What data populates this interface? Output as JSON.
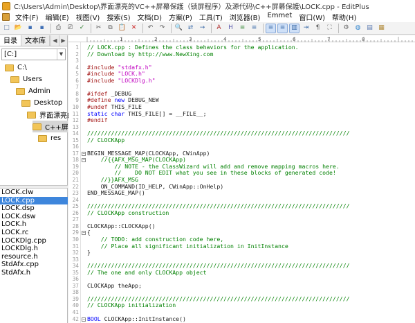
{
  "window": {
    "title": "C:\\Users\\Admin\\Desktop\\界面漂亮的VC++屏幕保護（锁屏程序）及源代码\\C++屏幕保護\\LOCK.cpp - EditPlus"
  },
  "menu": [
    "文件(F)",
    "编辑(E)",
    "视图(V)",
    "搜索(S)",
    "文档(D)",
    "方案(P)",
    "工具(T)",
    "浏览器(B)",
    "Emmet",
    "窗口(W)",
    "帮助(H)"
  ],
  "sidebar": {
    "tabs": [
      "目录",
      "文本库"
    ],
    "drive": "[C:]",
    "tree": [
      {
        "label": "C:\\",
        "indent": 0,
        "selected": false
      },
      {
        "label": "Users",
        "indent": 1,
        "selected": false
      },
      {
        "label": "Admin",
        "indent": 2,
        "selected": false
      },
      {
        "label": "Desktop",
        "indent": 3,
        "selected": false
      },
      {
        "label": "界面漂亮的VC+",
        "indent": 4,
        "selected": false
      },
      {
        "label": "C++屏幕保護",
        "indent": 5,
        "selected": true
      },
      {
        "label": "res",
        "indent": 6,
        "selected": false
      }
    ],
    "files": [
      {
        "name": "LOCK.clw",
        "selected": false
      },
      {
        "name": "LOCK.cpp",
        "selected": true
      },
      {
        "name": "LOCK.dsp",
        "selected": false
      },
      {
        "name": "LOCK.dsw",
        "selected": false
      },
      {
        "name": "LOCK.h",
        "selected": false
      },
      {
        "name": "LOCK.rc",
        "selected": false
      },
      {
        "name": "LOCKDlg.cpp",
        "selected": false
      },
      {
        "name": "LOCKDlg.h",
        "selected": false
      },
      {
        "name": "resource.h",
        "selected": false
      },
      {
        "name": "StdAfx.cpp",
        "selected": false
      },
      {
        "name": "StdAfx.h",
        "selected": false
      }
    ]
  },
  "ruler": {
    "labels": [
      "1",
      "2",
      "3",
      "4",
      "5",
      "6",
      "7",
      "8"
    ]
  },
  "toolbar": {
    "icons": [
      "new-file-icon",
      "open-icon",
      "save-icon",
      "save-all-icon",
      "print-icon",
      "print-preview-icon",
      "spell-check-icon",
      "cut-icon",
      "copy-icon",
      "paste-icon",
      "delete-icon",
      "undo-icon",
      "redo-icon",
      "find-icon",
      "replace-icon",
      "goto-icon",
      "font-icon",
      "hex-icon",
      "color-icon",
      "word-wrap-icon",
      "ruler-icon",
      "line-numbers-icon",
      "column-select-icon",
      "indent-icon",
      "whitespace-icon",
      "fullscreen-icon",
      "settings-icon",
      "browser-icon",
      "cliptext-icon",
      "directory-icon"
    ],
    "glyphs": [
      "□",
      "📂",
      "▪",
      "▪",
      "⎙",
      "⎚",
      "✓",
      "✂",
      "⧉",
      "📋",
      "✕",
      "↶",
      "↷",
      "🔍",
      "⇄",
      "→",
      "A",
      "H",
      "≡",
      "≡",
      "≡",
      "≡",
      "▥",
      "⇥",
      "¶",
      "⛶",
      "⚙",
      "◍",
      "▤",
      "▦"
    ],
    "active_indices": [
      20,
      21,
      22
    ]
  },
  "colors": {
    "comment": "#008000",
    "preprocessor": "#a31515",
    "string": "#c000c0",
    "keyword": "#0000ff",
    "selection": "#3e86dc"
  },
  "editor": {
    "lines": [
      {
        "n": "1",
        "fold": false,
        "tokens": [
          {
            "c": "cmt",
            "t": "// LOCK.cpp : Defines the class behaviors for the application."
          }
        ]
      },
      {
        "n": "2",
        "fold": false,
        "tokens": [
          {
            "c": "cmt",
            "t": "// Download by http://www.NewXing.com"
          }
        ]
      },
      {
        "n": "3",
        "fold": false,
        "tokens": []
      },
      {
        "n": "4",
        "fold": false,
        "tokens": [
          {
            "c": "pp",
            "t": "#include "
          },
          {
            "c": "str",
            "t": "\"stdafx.h\""
          }
        ]
      },
      {
        "n": "5",
        "fold": false,
        "tokens": [
          {
            "c": "pp",
            "t": "#include "
          },
          {
            "c": "str",
            "t": "\"LOCK.h\""
          }
        ]
      },
      {
        "n": "6",
        "fold": false,
        "tokens": [
          {
            "c": "pp",
            "t": "#include "
          },
          {
            "c": "str",
            "t": "\"LOCKDlg.h\""
          }
        ]
      },
      {
        "n": "7",
        "fold": false,
        "tokens": []
      },
      {
        "n": "8",
        "fold": false,
        "tokens": [
          {
            "c": "pp",
            "t": "#ifdef "
          },
          {
            "c": "plain",
            "t": "_DEBUG"
          }
        ]
      },
      {
        "n": "9",
        "fold": false,
        "tokens": [
          {
            "c": "pp",
            "t": "#define "
          },
          {
            "c": "kw",
            "t": "new "
          },
          {
            "c": "plain",
            "t": "DEBUG_NEW"
          }
        ]
      },
      {
        "n": "10",
        "fold": false,
        "tokens": [
          {
            "c": "pp",
            "t": "#undef "
          },
          {
            "c": "plain",
            "t": "THIS_FILE"
          }
        ]
      },
      {
        "n": "11",
        "fold": false,
        "tokens": [
          {
            "c": "kw",
            "t": "static char "
          },
          {
            "c": "plain",
            "t": "THIS_FILE[] = __FILE__;"
          }
        ]
      },
      {
        "n": "12",
        "fold": false,
        "tokens": [
          {
            "c": "pp",
            "t": "#endif"
          }
        ]
      },
      {
        "n": "13",
        "fold": false,
        "tokens": []
      },
      {
        "n": "14",
        "fold": false,
        "tokens": [
          {
            "c": "cmt",
            "t": "/////////////////////////////////////////////////////////////////////////////"
          }
        ]
      },
      {
        "n": "15",
        "fold": false,
        "tokens": [
          {
            "c": "cmt",
            "t": "// CLOCKApp"
          }
        ]
      },
      {
        "n": "16",
        "fold": false,
        "tokens": []
      },
      {
        "n": "17",
        "fold": true,
        "tokens": [
          {
            "c": "plain",
            "t": "BEGIN_MESSAGE_MAP(CLOCKApp, CWinApp)"
          }
        ]
      },
      {
        "n": "18",
        "fold": true,
        "tokens": [
          {
            "c": "cmt",
            "t": "    //{{AFX_MSG_MAP(CLOCKApp)"
          }
        ]
      },
      {
        "n": "19",
        "fold": false,
        "tokens": [
          {
            "c": "cmt",
            "t": "        // NOTE - the ClassWizard will add and remove mapping macros here."
          }
        ]
      },
      {
        "n": "20",
        "fold": false,
        "tokens": [
          {
            "c": "cmt",
            "t": "        //    DO NOT EDIT what you see in these blocks of generated code!"
          }
        ]
      },
      {
        "n": "21",
        "fold": false,
        "tokens": [
          {
            "c": "cmt",
            "t": "    //}}AFX_MSG"
          }
        ]
      },
      {
        "n": "22",
        "fold": false,
        "tokens": [
          {
            "c": "plain",
            "t": "    ON_COMMAND(ID_HELP, CWinApp::OnHelp)"
          }
        ]
      },
      {
        "n": "23",
        "fold": false,
        "tokens": [
          {
            "c": "plain",
            "t": "END_MESSAGE_MAP()"
          }
        ]
      },
      {
        "n": "24",
        "fold": false,
        "tokens": []
      },
      {
        "n": "25",
        "fold": false,
        "tokens": [
          {
            "c": "cmt",
            "t": "/////////////////////////////////////////////////////////////////////////////"
          }
        ]
      },
      {
        "n": "26",
        "fold": false,
        "tokens": [
          {
            "c": "cmt",
            "t": "// CLOCKApp construction"
          }
        ]
      },
      {
        "n": "27",
        "fold": false,
        "tokens": []
      },
      {
        "n": "28",
        "fold": false,
        "tokens": [
          {
            "c": "plain",
            "t": "CLOCKApp::CLOCKApp()"
          }
        ]
      },
      {
        "n": "29",
        "fold": true,
        "tokens": [
          {
            "c": "plain",
            "t": "{"
          }
        ]
      },
      {
        "n": "30",
        "fold": false,
        "tokens": [
          {
            "c": "cmt",
            "t": "    // TODO: add construction code here,"
          }
        ]
      },
      {
        "n": "31",
        "fold": false,
        "tokens": [
          {
            "c": "cmt",
            "t": "    // Place all significant initialization in InitInstance"
          }
        ]
      },
      {
        "n": "32",
        "fold": false,
        "tokens": [
          {
            "c": "plain",
            "t": "}"
          }
        ]
      },
      {
        "n": "33",
        "fold": false,
        "tokens": []
      },
      {
        "n": "34",
        "fold": false,
        "tokens": [
          {
            "c": "cmt",
            "t": "/////////////////////////////////////////////////////////////////////////////"
          }
        ]
      },
      {
        "n": "35",
        "fold": false,
        "tokens": [
          {
            "c": "cmt",
            "t": "// The one and only CLOCKApp object"
          }
        ]
      },
      {
        "n": "36",
        "fold": false,
        "tokens": []
      },
      {
        "n": "37",
        "fold": false,
        "tokens": [
          {
            "c": "plain",
            "t": "CLOCKApp theApp;"
          }
        ]
      },
      {
        "n": "38",
        "fold": false,
        "tokens": []
      },
      {
        "n": "39",
        "fold": false,
        "tokens": [
          {
            "c": "cmt",
            "t": "/////////////////////////////////////////////////////////////////////////////"
          }
        ]
      },
      {
        "n": "40",
        "fold": false,
        "tokens": [
          {
            "c": "cmt",
            "t": "// CLOCKApp initialization"
          }
        ]
      },
      {
        "n": "41",
        "fold": false,
        "tokens": []
      },
      {
        "n": "42",
        "fold": true,
        "tokens": [
          {
            "c": "kw",
            "t": "BOOL "
          },
          {
            "c": "plain",
            "t": "CLOCKApp::InitInstance()"
          }
        ]
      }
    ]
  }
}
